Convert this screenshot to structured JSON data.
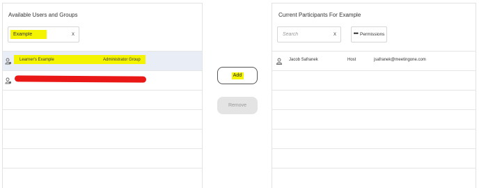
{
  "available": {
    "title": "Available Users and Groups",
    "search": {
      "value": "Example",
      "clear_glyph": "x"
    },
    "rows": [
      {
        "name": "Learner's Example",
        "group": "Administrator Group",
        "icon": "user-group-icon",
        "selected": true,
        "highlight_color": "#f4f400"
      },
      {
        "name": "",
        "group": "",
        "icon": "user-group-icon",
        "redacted": true,
        "redaction_color": "#ea1717"
      }
    ]
  },
  "actions": {
    "add_label": "Add",
    "remove_label": "Remove",
    "remove_disabled": true
  },
  "participants": {
    "title": "Current Participants For Example",
    "search": {
      "placeholder": "Search",
      "clear_glyph": "x"
    },
    "permissions_label": "Permissions",
    "permissions_glyph": "•••",
    "rows": [
      {
        "name": "Jacob Safranek",
        "role": "Host",
        "email": "jsafranek@meetingone.com",
        "icon": "user-icon"
      }
    ]
  },
  "colors": {
    "highlight": "#f4f400",
    "selected_row": "#e8edf6",
    "redaction": "#ea1717",
    "disabled_button": "#e4e4e4"
  }
}
